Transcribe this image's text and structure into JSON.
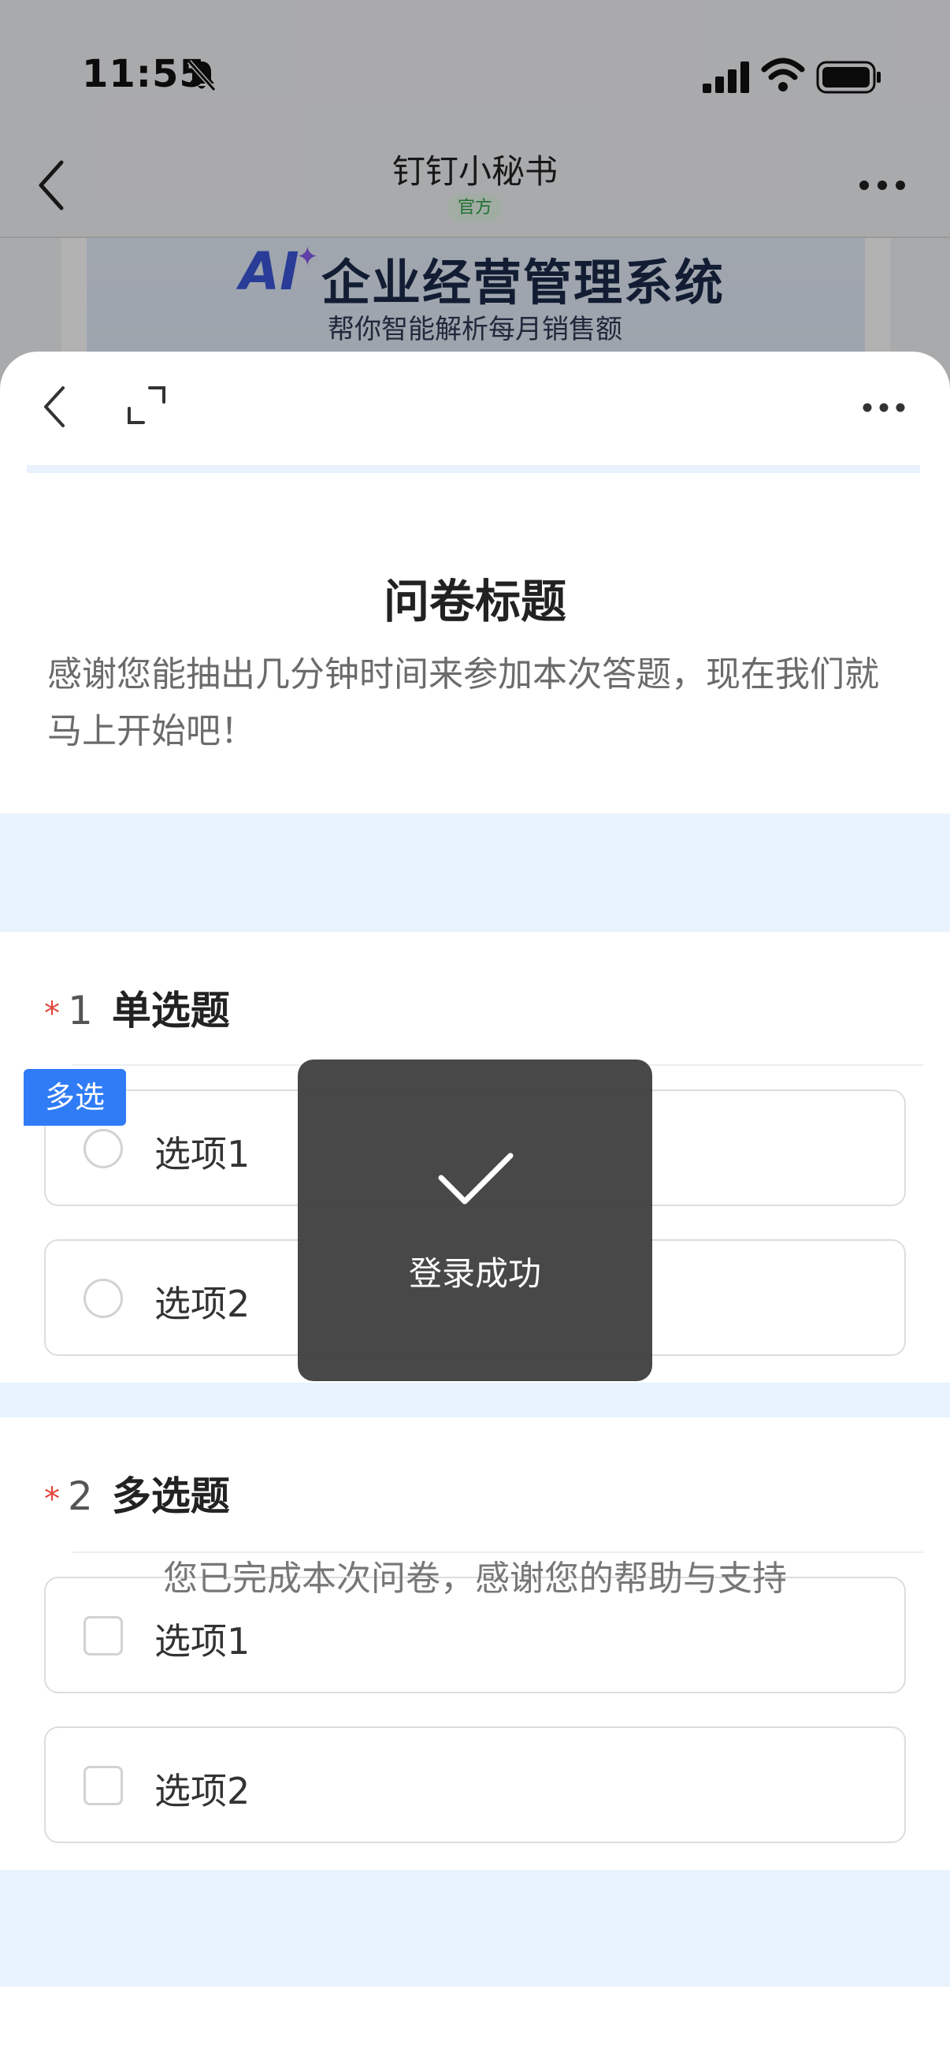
{
  "status_bar": {
    "time": "11:55"
  },
  "chat_header": {
    "title": "钉钉小秘书",
    "badge": "官方"
  },
  "banner": {
    "ai": "AI",
    "title": "企业经营管理系统",
    "subtitle": "帮你智能解析每月销售额"
  },
  "survey": {
    "title": "问卷标题",
    "description": "感谢您能抽出几分钟时间来参加本次答题，现在我们就马上开始吧！",
    "questions": [
      {
        "required": "*",
        "number": "1",
        "title": "单选题",
        "options": [
          "选项1",
          "选项2"
        ]
      },
      {
        "tag": "多选",
        "required": "*",
        "number": "2",
        "title": "多选题",
        "options": [
          "选项1",
          "选项2"
        ]
      }
    ],
    "footer": "您已完成本次问卷，感谢您的帮助与支持"
  },
  "toast": {
    "text": "登录成功"
  },
  "icons": {
    "status": [
      "bell-slash-icon",
      "signal-icon",
      "wifi-icon",
      "battery-icon"
    ],
    "nav": [
      "back-icon",
      "more-icon",
      "expand-icon",
      "checkmark-icon"
    ]
  },
  "colors": {
    "accent": "#2f7cf6",
    "required": "#e2453c",
    "band": "#e9f3fd",
    "toast_bg": "#383838"
  }
}
